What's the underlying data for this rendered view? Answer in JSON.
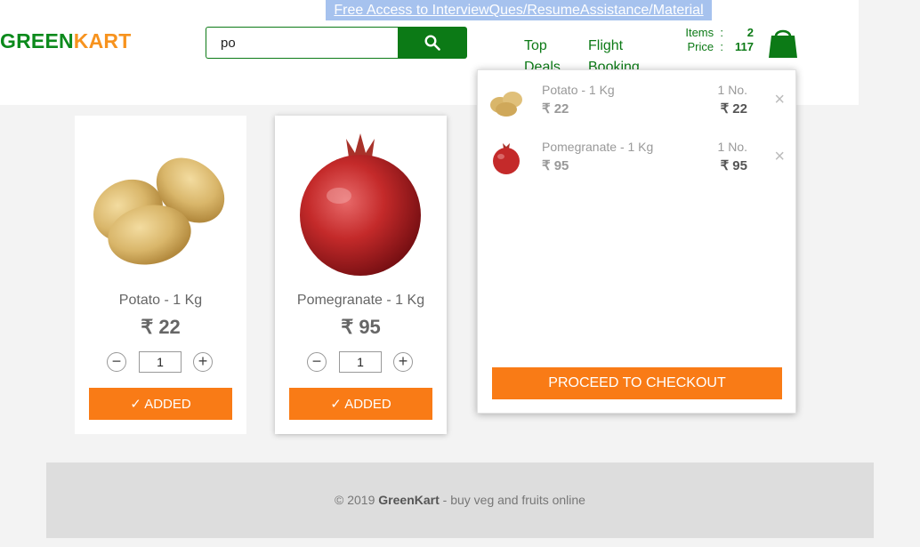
{
  "banner": {
    "link_text": "Free Access to InterviewQues/ResumeAssistance/Material"
  },
  "brand": {
    "part1": "GREEN",
    "part2": "KART"
  },
  "search": {
    "value": "po",
    "button_icon": "search-icon"
  },
  "nav": {
    "items": [
      {
        "label": "Top Deals"
      },
      {
        "label": "Flight Booking"
      }
    ]
  },
  "cart_summary": {
    "items_label": "Items",
    "items_value": "2",
    "price_label": "Price",
    "price_value": "117",
    "separator": ":"
  },
  "products": [
    {
      "name": "Potato - 1 Kg",
      "price": "₹ 22",
      "qty": "1",
      "button_label": "✓ ADDED",
      "minus": "−",
      "plus": "+"
    },
    {
      "name": "Pomegranate - 1 Kg",
      "price": "₹ 95",
      "qty": "1",
      "button_label": "✓ ADDED",
      "minus": "−",
      "plus": "+"
    }
  ],
  "cart_preview": {
    "items": [
      {
        "name": "Potato - 1 Kg",
        "price": "₹ 22",
        "qty": "1 No.",
        "amount": "₹ 22",
        "remove": "×"
      },
      {
        "name": "Pomegranate - 1 Kg",
        "price": "₹ 95",
        "qty": "1 No.",
        "amount": "₹ 95",
        "remove": "×"
      }
    ],
    "checkout_label": "PROCEED TO CHECKOUT"
  },
  "footer": {
    "copyright": "© 2019",
    "brand": "GreenKart",
    "tagline": "- buy veg and fruits online"
  },
  "colors": {
    "brand_green": "#0c7a16",
    "brand_orange": "#f97b16",
    "banner_blue": "#a6c2ee"
  }
}
